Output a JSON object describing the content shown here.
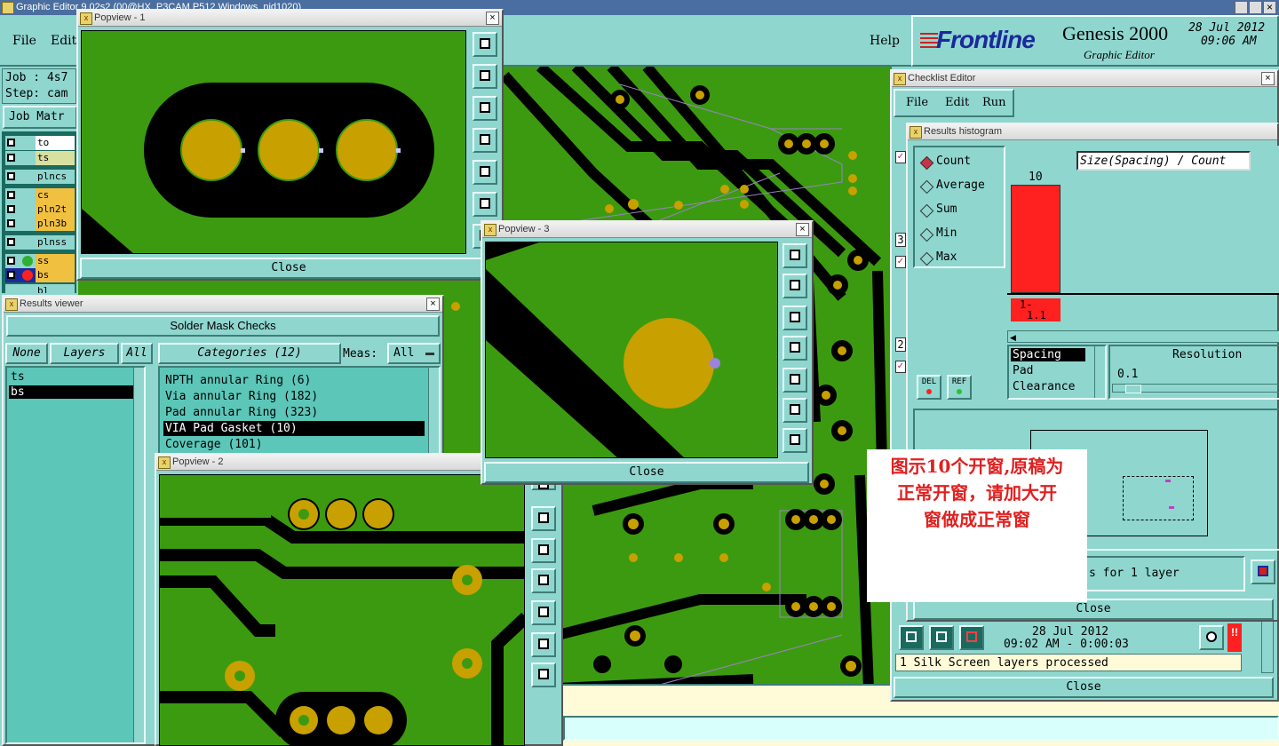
{
  "main": {
    "title": "Graphic Editor  9.02s2 (00@HX_P3CAM P512  Windows_nid1020)",
    "menu": {
      "file": "File",
      "edit": "Edit",
      "help": "Help"
    },
    "job": "Job : 4s7",
    "step": "Step: cam",
    "job_matrix": "Job Matr",
    "layers": [
      "to",
      "ts",
      "plncs",
      "cs",
      "pln2t",
      "pln3b",
      "plnss",
      "ss",
      "bs",
      "bl"
    ]
  },
  "brand": {
    "logo": "Frontline",
    "product": "Genesis 2000",
    "subtitle": "Graphic Editor",
    "date": "28 Jul 2012",
    "time": "09:06 AM"
  },
  "popview1": {
    "title": "Popview - 1",
    "close": "Close"
  },
  "popview2": {
    "title": "Popview - 2"
  },
  "popview3": {
    "title": "Popview - 3",
    "close": "Close"
  },
  "results_viewer": {
    "title": "Results viewer",
    "heading": "Solder Mask Checks",
    "none_btn": "None",
    "layers_btn": "Layers",
    "all_btn": "All",
    "categories_label": "Categories (12)",
    "meas_label": "Meas:",
    "meas_value": "All",
    "layers": [
      "ts",
      "bs"
    ],
    "categories": [
      "NPTH annular Ring (6)",
      "Via annular Ring (182)",
      "Pad annular Ring (323)",
      "VIA Pad Gasket (10)",
      "Coverage (101)"
    ]
  },
  "checklist": {
    "title": "Checklist Editor",
    "menu": {
      "file": "File",
      "edit": "Edit",
      "run": "Run"
    },
    "date": "28 Jul 2012",
    "time": "09:02 AM - 0:00:03",
    "status": "1 Silk Screen layers processed",
    "close": "Close",
    "row_nums": [
      "3",
      "2"
    ]
  },
  "histogram": {
    "title": "Results histogram",
    "modes": [
      "Count",
      "Average",
      "Sum",
      "Min",
      "Max"
    ],
    "selected_mode": "Count",
    "header": "Size(Spacing) / Count",
    "bar_value": "10",
    "bar_label_1": "1-",
    "bar_label_2": "1.1",
    "del": "DEL",
    "ref": "REF",
    "metrics": [
      "Spacing",
      "Pad",
      "Clearance"
    ],
    "resolution_label": "Resolution",
    "resolution_value": "0.1",
    "footer": "s for 1 layer",
    "close": "Close"
  },
  "annotation": {
    "line1": "图示10个开窗,原稿为",
    "line2": "正常开窗，请加大开",
    "line3": "窗做成正常窗"
  },
  "colors": {
    "panel": "#8fd6cf",
    "pcb_green": "#3c9a10",
    "copper": "#c8a000",
    "bar_red": "#ff2020",
    "title_blue": "#4a6ea0"
  }
}
